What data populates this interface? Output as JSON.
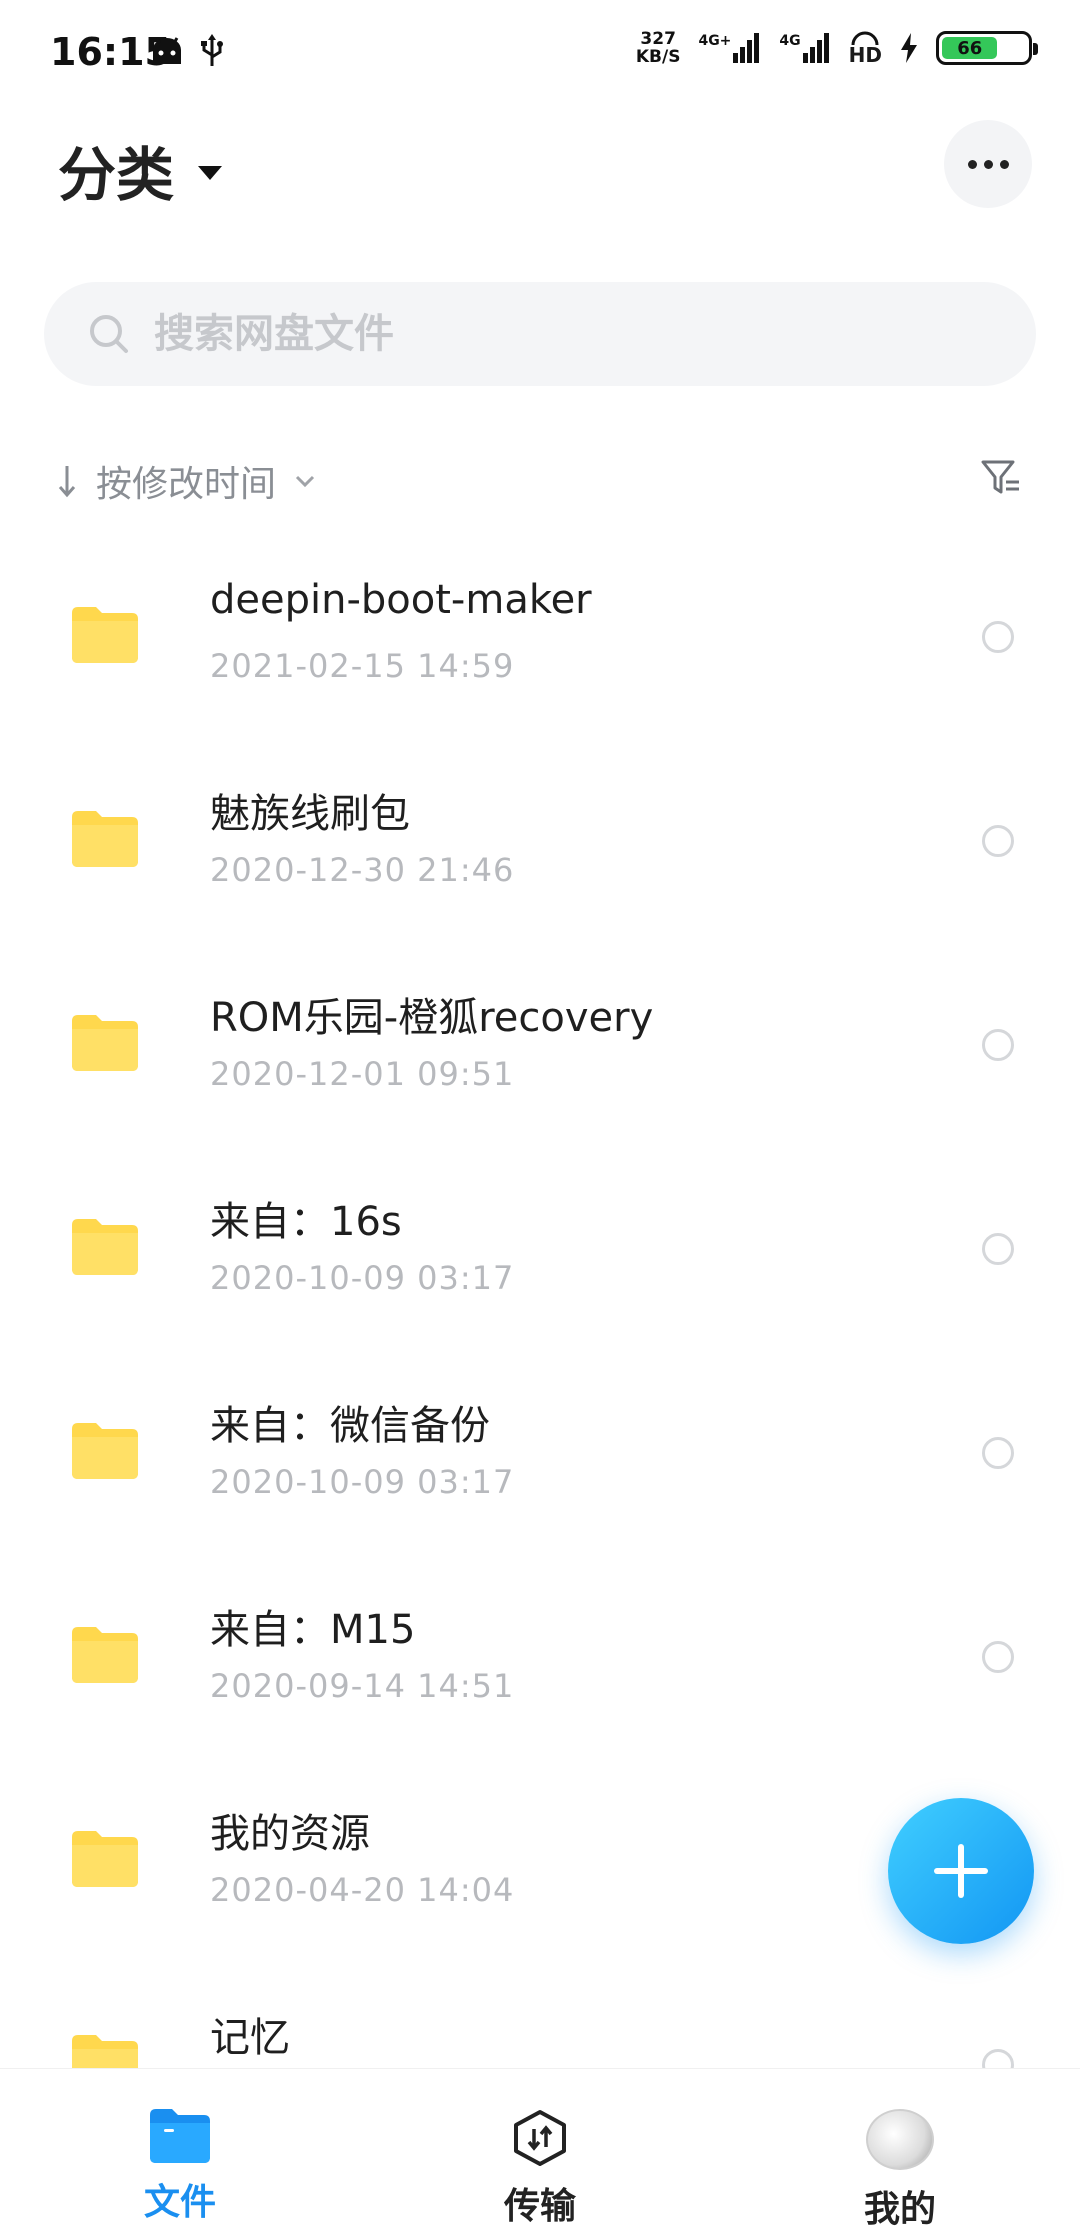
{
  "status_bar": {
    "time": "16:15",
    "net_speed_value": "327",
    "net_speed_unit": "KB/S",
    "net_type_1": "4G+",
    "net_type_2": "4G",
    "hd_label": "HD",
    "battery_level": "66"
  },
  "header": {
    "title": "分类"
  },
  "search": {
    "placeholder": "搜索网盘文件"
  },
  "sort": {
    "label": "按修改时间"
  },
  "files": [
    {
      "name": "deepin-boot-maker",
      "date": "2021-02-15  14:59"
    },
    {
      "name": "魅族线刷包",
      "date": "2020-12-30  21:46"
    },
    {
      "name": "ROM乐园-橙狐recovery",
      "date": "2020-12-01  09:51"
    },
    {
      "name": "来自：16s",
      "date": "2020-10-09  03:17"
    },
    {
      "name": "来自：微信备份",
      "date": "2020-10-09  03:17"
    },
    {
      "name": "来自：M15",
      "date": "2020-09-14  14:51"
    },
    {
      "name": "我的资源",
      "date": "2020-04-20  14:04"
    },
    {
      "name": "记忆",
      "date": ""
    }
  ],
  "bottom_nav": {
    "files": "文件",
    "transfer": "传输",
    "mine": "我的"
  },
  "colors": {
    "accent": "#1a8ff0",
    "folder": "#ffd84d",
    "fab_start": "#41cfff",
    "fab_end": "#1296f3"
  }
}
